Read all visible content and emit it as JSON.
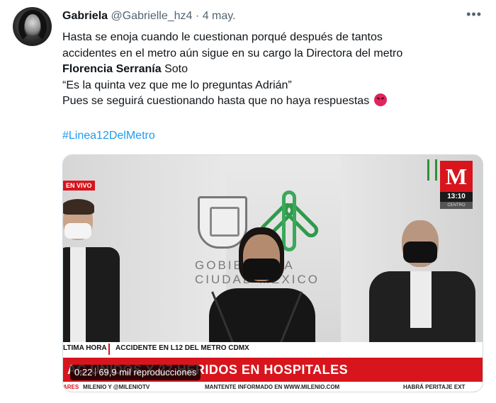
{
  "tweet": {
    "author_name": "Gabriela",
    "handle": "@Gabrielle_hz4",
    "separator": "·",
    "date": "4 may.",
    "more_icon": "more-horizontal-icon",
    "text": {
      "line1": "Hasta se enoja cuando le cuestionan porqué después de tantos",
      "line2": "accidentes en el metro aún sigue en su cargo la Directora del metro",
      "bold_name": "Florencia Serranía",
      "after_name": " Soto",
      "line4": "“Es la quinta vez que me lo preguntas Adrián”",
      "line5": "Pues se seguirá cuestionando hasta que no haya respuestas",
      "emoji": "angry-face-icon"
    },
    "hashtag": "#Linea12DelMetro"
  },
  "video": {
    "live_badge": "EN VIVO",
    "channel_logo": "M",
    "clock": "13:10",
    "region": "CENTRO",
    "backdrop_line1": "GOBIE    DE LA",
    "backdrop_line2": "CIUDAD   MÉXICO",
    "breaking_label": "LTIMA HORA",
    "subheadline": "ACCIDENTE EN L12 DEL METRO CDMX",
    "headline": "AC    UNIDOS Y 27 HERIDOS EN HOSPITALES",
    "ticker": {
      "t1": "ARES",
      "t2": "MILENIO Y @MILENIOTV",
      "t3": "MANTENTE INFORMADO EN WWW.MILENIO.COM",
      "t4": "HABRÁ PERITAJE EXT"
    },
    "elapsed": "0:22",
    "views": "69,9 mil reproducciones",
    "colors": {
      "accent_red": "#d8151d",
      "link_blue": "#1d9bf0"
    }
  }
}
